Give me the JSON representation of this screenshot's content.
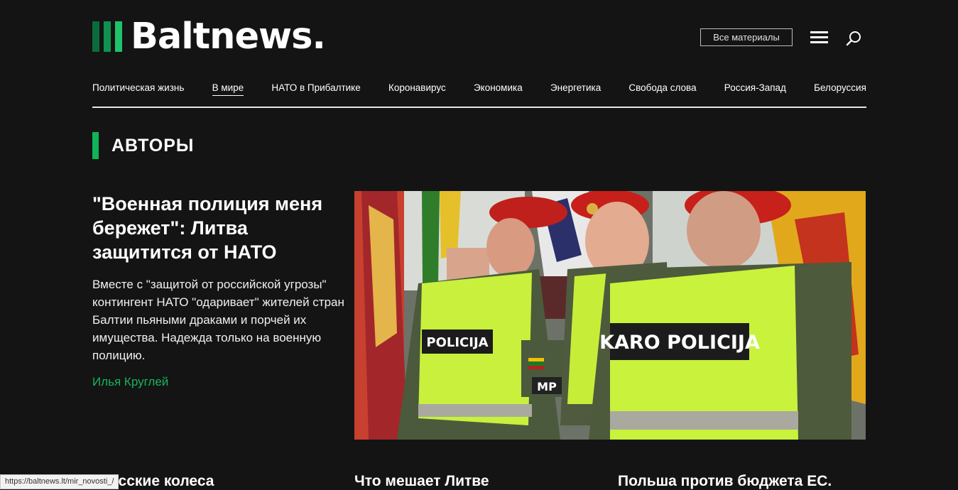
{
  "header": {
    "logo_text": "Baltnews.",
    "all_materials_label": "Все материалы",
    "menu_icon": "hamburger-menu-icon",
    "search_icon": "search-icon"
  },
  "nav": {
    "items": [
      {
        "label": "Политическая жизнь",
        "active": false
      },
      {
        "label": "В мире",
        "active": true
      },
      {
        "label": "НАТО в Прибалтике",
        "active": false
      },
      {
        "label": "Коронавирус",
        "active": false
      },
      {
        "label": "Экономика",
        "active": false
      },
      {
        "label": "Энергетика",
        "active": false
      },
      {
        "label": "Свобода слова",
        "active": false
      },
      {
        "label": "Россия-Запад",
        "active": false
      },
      {
        "label": "Белоруссия",
        "active": false
      }
    ]
  },
  "section": {
    "title": "АВТОРЫ"
  },
  "lead": {
    "title": "\"Военная полиция меня бережет\": Литва защитится от НАТО",
    "text": "Вместе с \"защитой от российской угрозы\" контингент НАТО \"одаривает\" жителей стран Балтии пьяными драками и порчей их имущества. Надежда только на военную полицию.",
    "author": "Илья Круглей",
    "image_text_vest": "KARO POLICIJA",
    "image_text_vest_left": "POLICIJA",
    "image_text_patch": "MP"
  },
  "cards": [
    {
      "title": "орусские колеса"
    },
    {
      "title": "Что мешает Литве"
    },
    {
      "title": "Польша против бюджета ЕС."
    }
  ],
  "status_bar": {
    "url": "https://baltnews.lt/mir_novosti_/"
  },
  "colors": {
    "background": "#141414",
    "accent_green": "#10b35a",
    "author_green": "#15b55c"
  }
}
